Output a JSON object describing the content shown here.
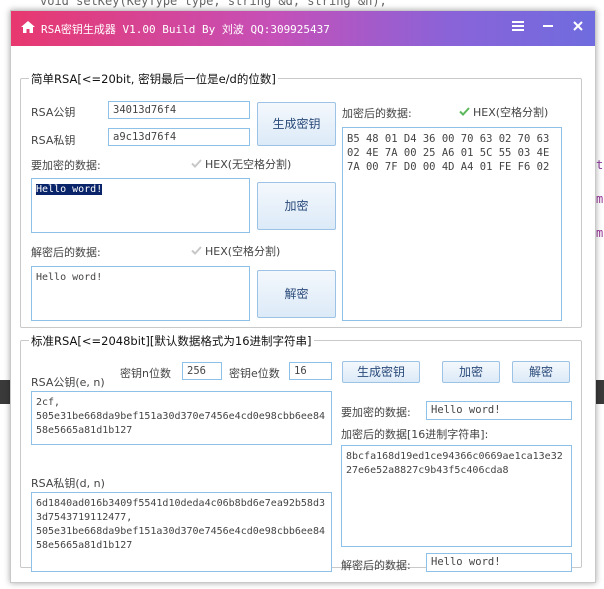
{
  "background": {
    "code_line": "void setKey(KeyType type, string &d, string &n);",
    "right_fragment_1": "t",
    "right_fragment_2": "mp",
    "right_fragment_3": "mp"
  },
  "titlebar": {
    "title": "RSA密钥生成器 V1.00 Build By 刘波 QQ:309925437",
    "menu_icon": "hamburger-icon",
    "minimize_icon": "minimize-icon",
    "close_icon": "close-icon",
    "home_icon": "home-icon"
  },
  "simple": {
    "title": "简单RSA[<=20bit, 密钥最后一位是e/d的位数]",
    "pub_label": "RSA公钥",
    "pub_value": "34013d76f4",
    "priv_label": "RSA私钥",
    "priv_value": "a9c13d76f4",
    "gen_button": "生成密钥",
    "plain_label": "要加密的数据:",
    "hex_nospace_label": "HEX(无空格分割)",
    "plain_value": "Hello word!",
    "encrypt_button": "加密",
    "decrypted_label": "解密后的数据:",
    "hex_space_label": "HEX(空格分割)",
    "decrypted_value": "Hello word!",
    "decrypt_button": "解密",
    "encrypted_label": "加密后的数据:",
    "encrypted_hex_label": "HEX(空格分割)",
    "encrypted_value": "B5 48 01 D4 36 00 70 63 02 70 63 02 4E 7A 00 25 A6 01 5C 55 03 4E 7A 00 7F D0 00 4D A4 01 FE F6 02"
  },
  "standard": {
    "title": "标准RSA[<=2048bit][默认数据格式为16进制字符串]",
    "pub_label": "RSA公钥(e, n)",
    "n_bits_label": "密钥n位数",
    "n_bits_value": "256",
    "e_bits_label": "密钥e位数",
    "e_bits_value": "16",
    "gen_button": "生成密钥",
    "encrypt_button": "加密",
    "decrypt_button": "解密",
    "pub_value": "2cf,\n505e31be668da9bef151a30d370e7456e4cd0e98cbb6ee8458e5665a81d1b127",
    "priv_label": "RSA私钥(d, n)",
    "priv_value": "6d1840ad016b3409f5541d10deda4c06b8bd6e7ea92b58d33d7543719112477,\n505e31be668da9bef151a30d370e7456e4cd0e98cbb6ee8458e5665a81d1b127",
    "plain_label": "要加密的数据:",
    "plain_value": "Hello word!",
    "encrypted_label": "加密后的数据[16进制字符串]:",
    "encrypted_value": "8bcfa168d19ed1ce94366c0669ae1ca13e3227e6e52a8827c9b43f5c406cda8",
    "decrypted_label": "解密后的数据:",
    "decrypted_value": "Hello word!"
  },
  "colors": {
    "title_gradient_start": "#e8386f",
    "title_gradient_end": "#6f6cdf",
    "input_border": "#8fc1e8",
    "button_text": "#2a4a7a",
    "check_color": "#5cb85c"
  }
}
